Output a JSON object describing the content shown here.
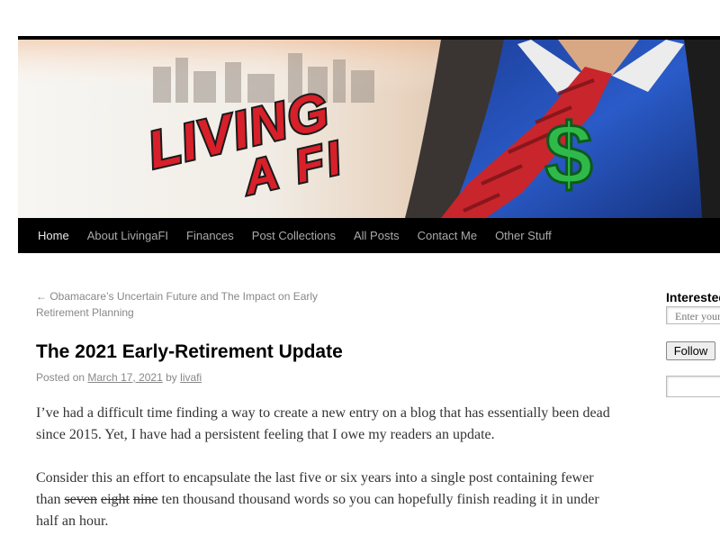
{
  "header": {
    "logo_line1": "LIVING",
    "logo_line2": "A FI",
    "dollar_symbol": "$",
    "colors": {
      "logo_red": "#d7202a",
      "tie_red": "#c8262c",
      "shirt_blue": "#2a5bc8",
      "dollar_green": "#2fb94a"
    }
  },
  "nav": {
    "items": [
      "Home",
      "About LivingaFI",
      "Finances",
      "Post Collections",
      "All Posts",
      "Contact Me",
      "Other Stuff"
    ]
  },
  "post": {
    "prev_link": "← Obamacare’s Uncertain Future and The Impact on Early Retirement Planning",
    "title": "The 2021 Early-Retirement Update",
    "meta_posted_on": "Posted on",
    "date": "March 17, 2021",
    "meta_by": "by",
    "author": "livafi",
    "para1": "I’ve had a difficult time finding a way to create a new entry on a blog that has essentially been dead since 2015.  Yet, I have had a persistent feeling that I owe my readers an update.",
    "para2_before": "Consider this an effort to encapsulate the last five or six years into a single post containing fewer than ",
    "para2_strike1": "seven",
    "para2_strike2": "eight",
    "para2_strike3": "nine",
    "para2_after": " ten thousand thousand words so you can hopefully finish reading it in under half an hour."
  },
  "sidebar": {
    "widget_title": "Interested",
    "email_placeholder": "Enter your email",
    "follow_label": "Follow"
  }
}
